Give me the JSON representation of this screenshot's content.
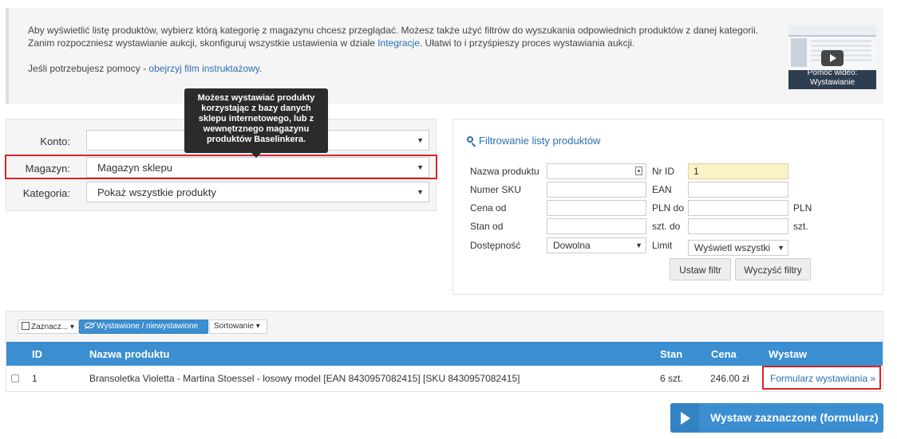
{
  "info": {
    "line1": "Aby wyświetlić listę produktów, wybierz którą kategorię z magazynu chcesz przeglądać. Możesz także użyć filtrów do wyszukania odpowiednich produktów z danej kategorii.",
    "line2_pre": "Zanim rozpoczniesz wystawianie aukcji, skonfiguruj wszystkie ustawienia w dziale ",
    "line2_link": "Integracje",
    "line2_post": ". Ułatwi to i przyśpieszy proces wystawiania aukcji.",
    "help_pre": "Jeśli potrzebujesz pomocy - ",
    "help_link": "obejrzyj film instruktażowy",
    "help_post": ".",
    "video_caption_1": "Pomoc wideo:",
    "video_caption_2": "Wystawianie"
  },
  "selectors": {
    "konto_label": "Konto:",
    "konto_value": "",
    "magazyn_label": "Magazyn:",
    "magazyn_value": "Magazyn sklepu",
    "kategoria_label": "Kategoria:",
    "kategoria_value": "Pokaż wszystkie produkty"
  },
  "tooltip": {
    "l1": "Możesz wystawiać produkty",
    "l2": "korzystając z bazy danych",
    "l3": "sklepu internetowego, lub z",
    "l4": "wewnętrznego magazynu",
    "l5": "produktów Baselinkera."
  },
  "filter": {
    "title": "Filtrowanie listy produktów",
    "nazwa_label": "Nazwa produktu",
    "nazwa_value": "",
    "nrid_label": "Nr ID",
    "nrid_value": "1",
    "sku_label": "Numer SKU",
    "sku_value": "",
    "ean_label": "EAN",
    "ean_value": "",
    "cena_od_label": "Cena od",
    "cena_od_value": "",
    "pln_do_label": "PLN do",
    "cena_do_value": "",
    "pln_label": "PLN",
    "stan_od_label": "Stan od",
    "stan_od_value": "",
    "szt_do_label": "szt. do",
    "stan_do_value": "",
    "szt_label": "szt.",
    "dostepnosc_label": "Dostępność",
    "dostepnosc_value": "Dowolna",
    "limit_label": "Limit",
    "limit_value": "Wyświetl wszystki",
    "apply_label": "Ustaw filtr",
    "clear_label": "Wyczyść filtry"
  },
  "toolbar": {
    "select_label": "Zaznacz...",
    "listed_label": "Wystawione / niewystawione",
    "sort_label": "Sortowanie"
  },
  "table": {
    "headers": {
      "id": "ID",
      "name": "Nazwa produktu",
      "stock": "Stan",
      "price": "Cena",
      "list": "Wystaw"
    },
    "rows": [
      {
        "id": "1",
        "name": "Bransoletka Violetta - Martina Stoessel - losowy model [EAN 8430957082415] [SKU 8430957082415]",
        "stock": "6 szt.",
        "price": "246.00 zł",
        "action": "Formularz wystawiania »"
      }
    ]
  },
  "submit_label": "Wystaw zaznaczone (formularz)",
  "colors": {
    "accent": "#3b8ecf",
    "highlight_border": "#d9222a",
    "link": "#2a6fb4"
  }
}
